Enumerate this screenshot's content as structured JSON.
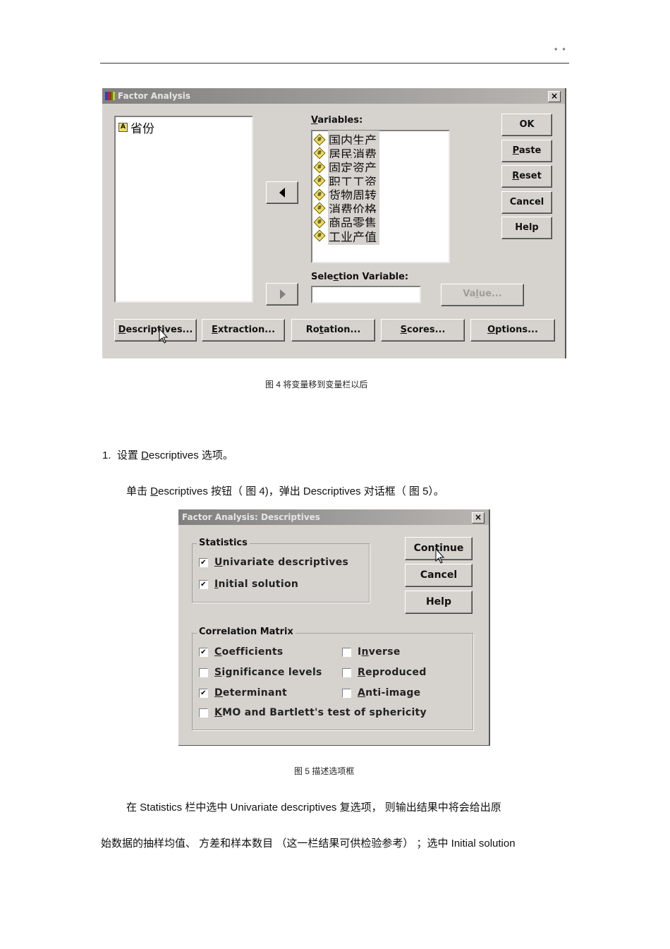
{
  "page_header": {
    "mark": "* *"
  },
  "figure4": {
    "window_title": "Factor Analysis",
    "close_label": "×",
    "source_list": [
      {
        "icon": "string-variable-icon",
        "label": "省份"
      }
    ],
    "variables_label_u": "V",
    "variables_label_rest": "ariables:",
    "variables": [
      {
        "icon": "numeric-variable-icon",
        "label": "国内生产"
      },
      {
        "icon": "numeric-variable-icon",
        "label": "居民消费"
      },
      {
        "icon": "numeric-variable-icon",
        "label": "固定资产"
      },
      {
        "icon": "numeric-variable-icon",
        "label": "职工工资"
      },
      {
        "icon": "numeric-variable-icon",
        "label": "货物周转"
      },
      {
        "icon": "numeric-variable-icon",
        "label": "消费价格"
      },
      {
        "icon": "numeric-variable-icon",
        "label": "商品零售"
      },
      {
        "icon": "numeric-variable-icon",
        "label": "工业产值"
      }
    ],
    "selection_label_a": "Sele",
    "selection_label_u": "c",
    "selection_label_b": "tion Variable:",
    "selection_value": "",
    "value_button": {
      "a": "Va",
      "u": "l",
      "b": "ue..."
    },
    "side_buttons": {
      "ok": "OK",
      "paste_u": "P",
      "paste_rest": "aste",
      "reset_u": "R",
      "reset_rest": "eset",
      "cancel": "Cancel",
      "help": "Help"
    },
    "bottom_buttons": {
      "descriptives_u": "D",
      "descriptives_rest": "escriptives...",
      "extraction_u": "E",
      "extraction_rest": "xtraction...",
      "rotation_a": "Ro",
      "rotation_u": "t",
      "rotation_b": "ation...",
      "scores_u": "S",
      "scores_rest": "cores...",
      "options_u": "O",
      "options_rest": "ptions..."
    },
    "caption": "图 4   将变量移到变量栏以后"
  },
  "section": {
    "heading_num": "1.",
    "heading_a": "设置 ",
    "heading_u": "D",
    "heading_b": "escriptives    选项。",
    "line_a": "单击 ",
    "line_u": "D",
    "line_b": "escriptives    按钮（ 图 4)，弹出  Descriptives    对话框（ 图 5）。"
  },
  "figure5": {
    "window_title": "Factor Analysis: Descriptives",
    "close_label": "×",
    "statistics_title": "Statistics",
    "statistics": [
      {
        "u": "U",
        "rest": "nivariate descriptives",
        "checked": true
      },
      {
        "u": "I",
        "rest": "nitial solution",
        "checked": true
      }
    ],
    "buttons": {
      "continue": "Continue",
      "cancel": "Cancel",
      "help": "Help"
    },
    "correlation_title": "Correlation Matrix",
    "correlation": [
      {
        "u": "C",
        "rest": "oefficients",
        "checked": true
      },
      {
        "u": "S",
        "rest": "ignificance levels",
        "checked": false
      },
      {
        "u": "D",
        "rest": "eterminant",
        "checked": true
      },
      {
        "u": "K",
        "rest": "MO and Bartlett's test of sphericity",
        "checked": false
      },
      {
        "a": "I",
        "u": "n",
        "rest": "verse",
        "checked": false
      },
      {
        "u": "R",
        "rest": "eproduced",
        "checked": false
      },
      {
        "u": "A",
        "rest": "nti-image",
        "checked": false
      }
    ],
    "check_glyph": "✔",
    "caption": "图 5   描述选项框"
  },
  "body_text": {
    "line1": "在 Statistics   栏中选中  Univariate descriptives      复选项，  则输出结果中将会给出原",
    "line2": "始数据的抽样均值、  方差和样本数目  （这一栏结果可供检验参考）   ；选中  Initial solution"
  }
}
